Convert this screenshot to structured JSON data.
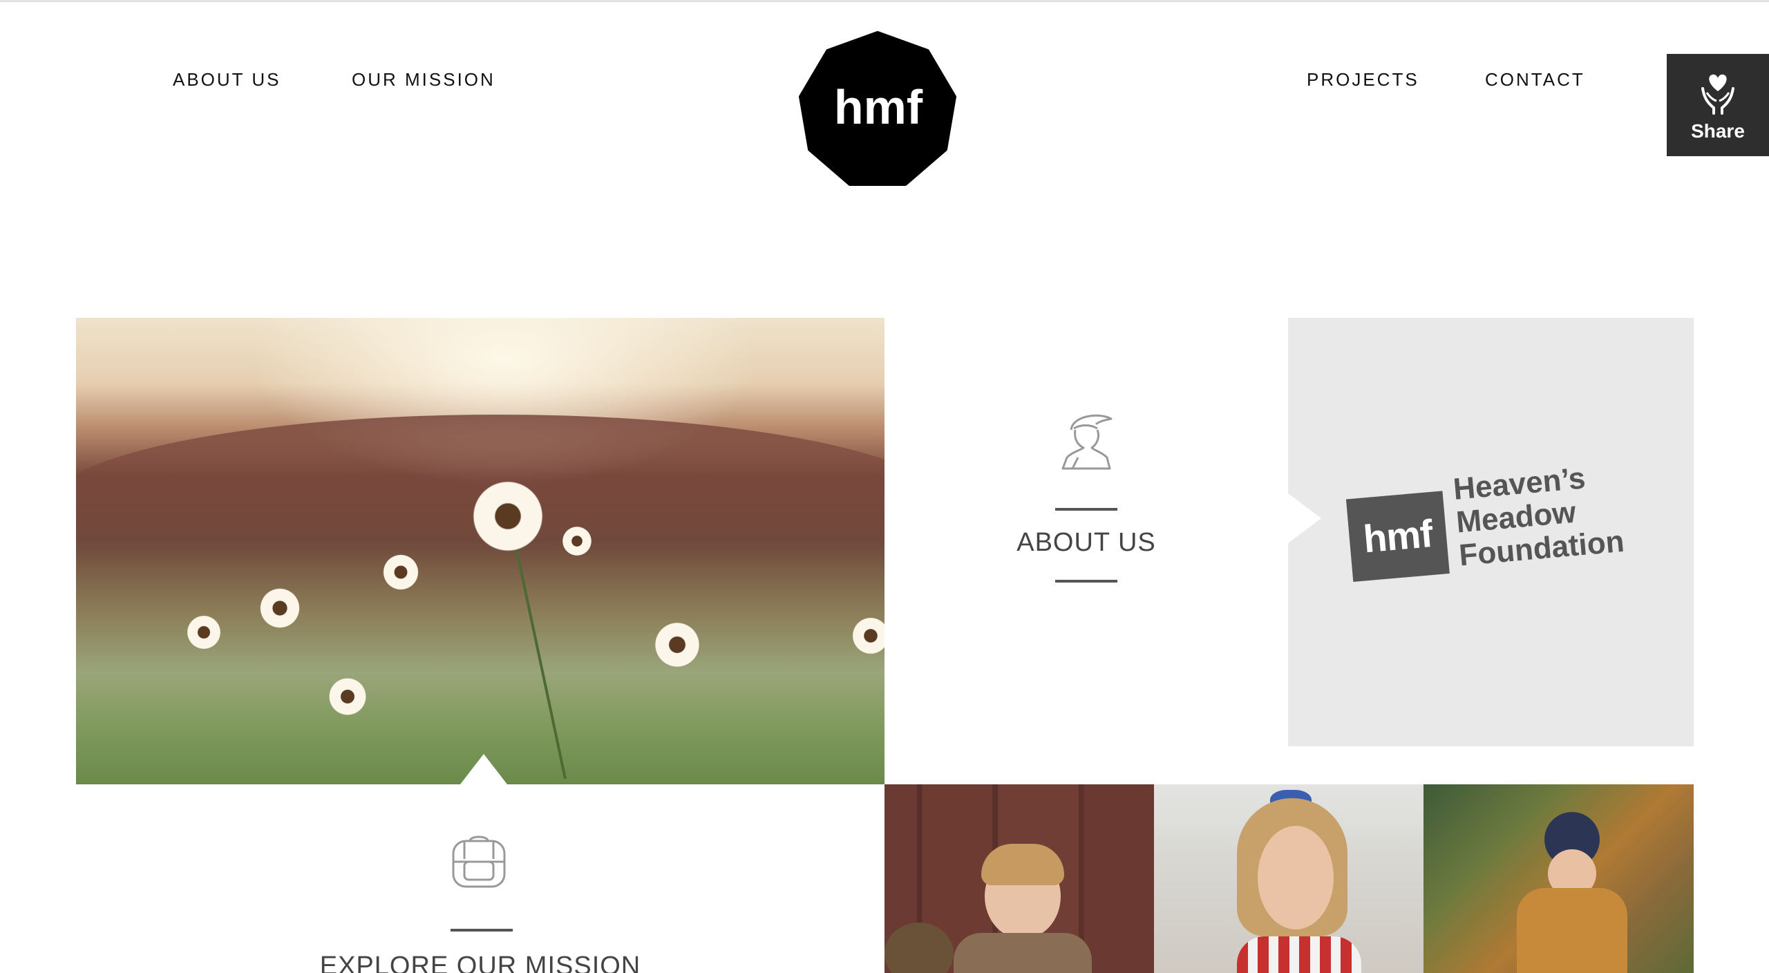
{
  "nav": {
    "left_items": [
      {
        "label": "ABOUT US"
      },
      {
        "label": "OUR MISSION"
      }
    ],
    "right_items": [
      {
        "label": "PROJECTS"
      },
      {
        "label": "CONTACT"
      }
    ],
    "logo_text": "hmf"
  },
  "share": {
    "label": "Share",
    "icon": "heart-hands-icon"
  },
  "about_tile": {
    "title": "ABOUT US",
    "icon": "woman-profile-icon"
  },
  "foundation": {
    "mark": "hmf",
    "name_lines": [
      "Heaven’s",
      "Meadow",
      "Foundation"
    ]
  },
  "mission_tile": {
    "title": "EXPLORE OUR MISSION",
    "icon": "backpack-icon"
  },
  "colors": {
    "share_bg": "#2e2e2e",
    "panel_bg": "#e9e9e9",
    "text_dark": "#111111",
    "text_muted": "#444444"
  }
}
